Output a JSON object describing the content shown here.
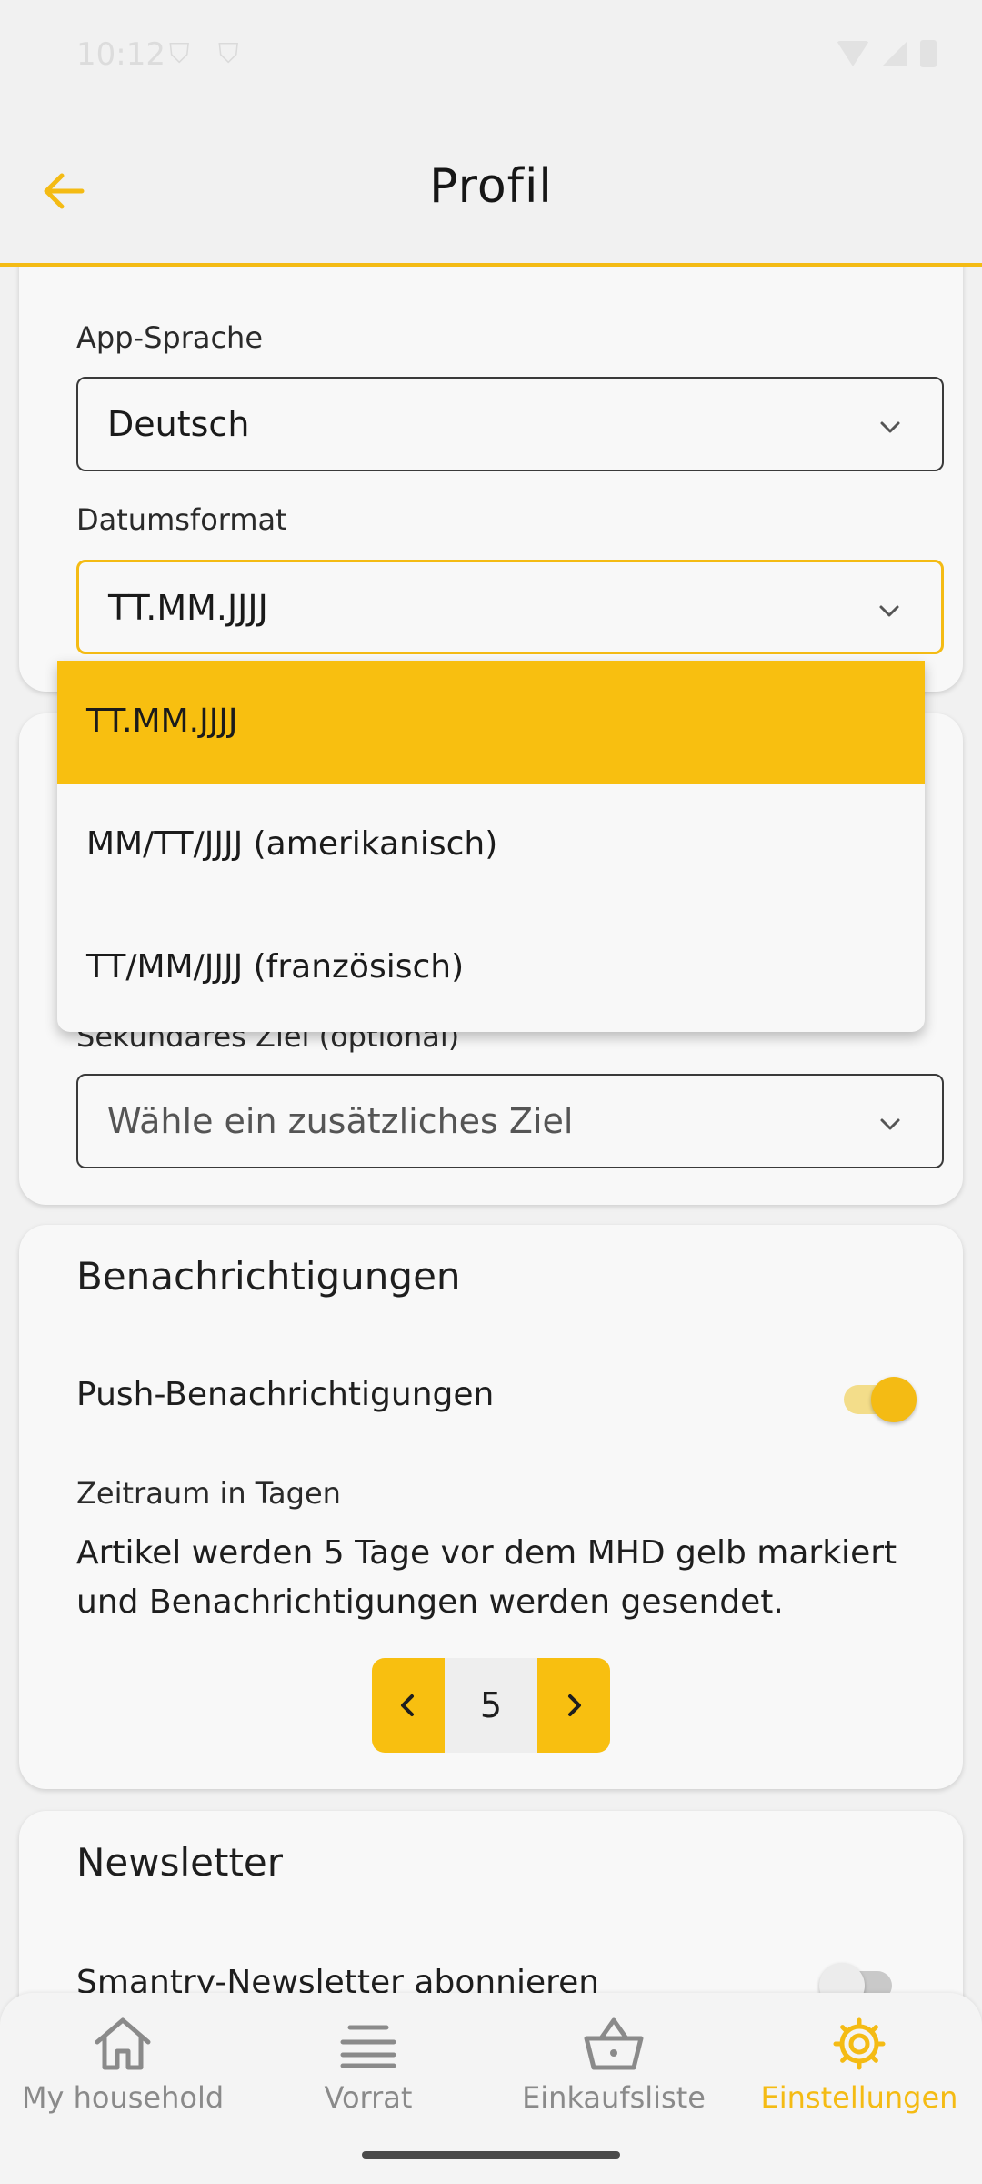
{
  "status_bar": {
    "time": "10:12"
  },
  "header": {
    "title": "Profil"
  },
  "language_card": {
    "language_label": "App-Sprache",
    "language_value": "Deutsch",
    "date_label": "Datumsformat",
    "date_value": "TT.MM.JJJJ"
  },
  "date_dropdown": {
    "options": [
      "TT.MM.JJJJ",
      "MM/TT/JJJJ (amerikanisch)",
      "TT/MM/JJJJ (französisch)"
    ],
    "selected": "TT.MM.JJJJ"
  },
  "goals_card": {
    "secondary_label": "Sekundäres Ziel (optional)",
    "secondary_placeholder": "Wähle ein zusätzliches Ziel"
  },
  "notifications_card": {
    "title": "Benachrichtigungen",
    "push_label": "Push-Benachrichtigungen",
    "push_enabled": true,
    "period_label": "Zeitraum in Tagen",
    "period_text": "Artikel werden 5 Tage vor dem MHD gelb markiert und Benachrichtigungen werden gesendet.",
    "days_value": "5"
  },
  "newsletter_card": {
    "title": "Newsletter",
    "subscribe_label": "Smantry-Newsletter abonnieren",
    "subscribe_enabled": false
  },
  "bottom_nav": {
    "items": [
      {
        "label": "My household",
        "icon": "home-icon"
      },
      {
        "label": "Vorrat",
        "icon": "stack-icon"
      },
      {
        "label": "Einkaufsliste",
        "icon": "basket-icon"
      },
      {
        "label": "Einstellungen",
        "icon": "gear-icon"
      }
    ],
    "active": "Einstellungen"
  },
  "colors": {
    "accent": "#f4bb14",
    "inactive": "#8a8a8a",
    "background": "#f1f1f1"
  }
}
